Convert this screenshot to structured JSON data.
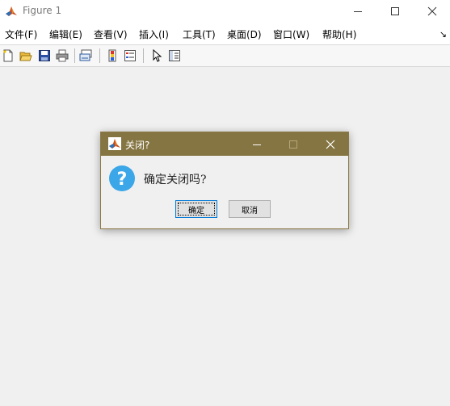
{
  "window": {
    "title": "Figure 1",
    "controls": [
      "minimize",
      "maximize",
      "close"
    ]
  },
  "menubar": {
    "items": [
      "文件(F)",
      "编辑(E)",
      "查看(V)",
      "插入(I)",
      "工具(T)",
      "桌面(D)",
      "窗口(W)",
      "帮助(H)"
    ],
    "overflow_icon": "dock-arrow-icon"
  },
  "toolbar": {
    "icons": [
      "new-figure-icon",
      "open-file-icon",
      "save-icon",
      "print-icon",
      "link-plot-icon",
      "insert-colorbar-icon",
      "insert-legend-icon",
      "edit-plot-icon",
      "open-property-inspector-icon"
    ]
  },
  "dialog": {
    "title": "关闭?",
    "message": "确定关闭吗?",
    "icon": "question-icon",
    "ok_label": "确定",
    "cancel_label": "取消"
  },
  "colors": {
    "dialog_titlebar": "#857542",
    "question_icon": "#3ba6e8",
    "background": "#f0f0f0"
  }
}
